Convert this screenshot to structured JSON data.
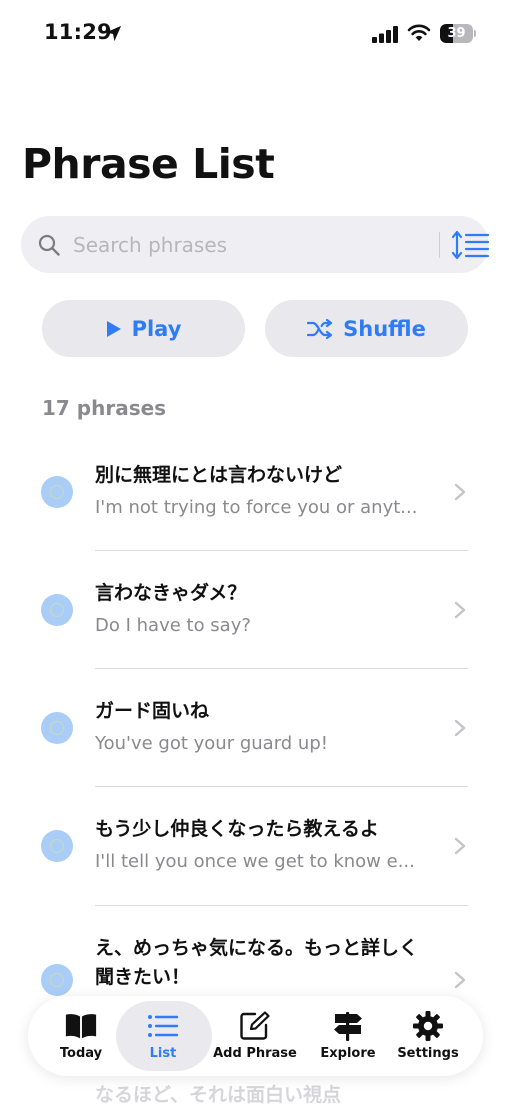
{
  "status_bar": {
    "time": "11:29",
    "battery_level": "39",
    "battery_fraction": 0.39
  },
  "header": {
    "title": "Phrase List"
  },
  "search": {
    "placeholder": "Search phrases",
    "value": ""
  },
  "actions": {
    "play_label": "Play",
    "shuffle_label": "Shuffle"
  },
  "count_label": "17 phrases",
  "phrases": [
    {
      "jp": "別に無理にとは言わないけど",
      "en": "I'm not trying to force you or anyt..."
    },
    {
      "jp": "言わなきゃダメ？",
      "en": "Do I have to say?"
    },
    {
      "jp": "ガード固いね",
      "en": "You've got your guard up!"
    },
    {
      "jp": "もう少し仲良くなったら教えるよ",
      "en": "I'll tell you once we get to know e..."
    },
    {
      "jp": "え、めっちゃ気になる。もっと詳しく聞きたい！",
      "en": ""
    }
  ],
  "partially_visible_phrase": "なるほど、それは面白い視点",
  "tabs": [
    {
      "label": "Today",
      "icon": "book-icon",
      "active": false
    },
    {
      "label": "List",
      "icon": "list-icon",
      "active": true
    },
    {
      "label": "Add Phrase",
      "icon": "compose-icon",
      "active": false
    },
    {
      "label": "Explore",
      "icon": "signpost-icon",
      "active": false
    },
    {
      "label": "Settings",
      "icon": "gear-icon",
      "active": false
    }
  ],
  "colors": {
    "accent": "#2f7cf6",
    "dot": "#a9cdf7",
    "secondary_text": "#8a8a8e",
    "field_bg": "#efeff3",
    "button_bg": "#e8e8ed"
  }
}
